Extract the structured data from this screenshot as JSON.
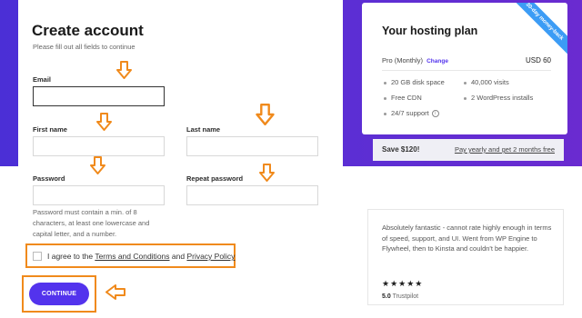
{
  "form": {
    "title": "Create account",
    "subtitle": "Please fill out all fields to continue",
    "email_label": "Email",
    "first_name_label": "First name",
    "last_name_label": "Last name",
    "password_label": "Password",
    "repeat_password_label": "Repeat password",
    "email_value": "",
    "first_name_value": "",
    "last_name_value": "",
    "password_value": "",
    "repeat_password_value": "",
    "password_hint": "Password must contain a min. of 8 characters, at least one lowercase and capital letter, and a number.",
    "agree_prefix": "I agree to the ",
    "terms_link": "Terms and Conditions",
    "agree_and": " and ",
    "privacy_link": "Privacy Policy",
    "continue_label": "CONTINUE"
  },
  "plan": {
    "title": "Your hosting plan",
    "ribbon": "30-day money-back",
    "name": "Pro (Monthly)",
    "change_label": "Change",
    "price": "USD 60",
    "features_left": [
      "20 GB disk space",
      "Free CDN",
      "24/7 support"
    ],
    "features_right": [
      "40,000 visits",
      "2 WordPress installs"
    ]
  },
  "save": {
    "label": "Save $120!",
    "link": "Pay yearly and get 2 months free"
  },
  "testimonial": {
    "text": "Absolutely fantastic - cannot rate highly enough in terms of speed, support, and UI. Went from WP Engine to Flywheel, then to Kinsta and couldn't be happier.",
    "stars": "★★★★★",
    "score": "5.0",
    "source": "Trustpilot"
  },
  "colors": {
    "accent": "#5333ed",
    "annotation": "#f08a1c",
    "ribbon": "#3c9cf5"
  },
  "icons": [
    "arrow-down-icon",
    "arrow-left-icon",
    "info-icon",
    "star-icon"
  ]
}
